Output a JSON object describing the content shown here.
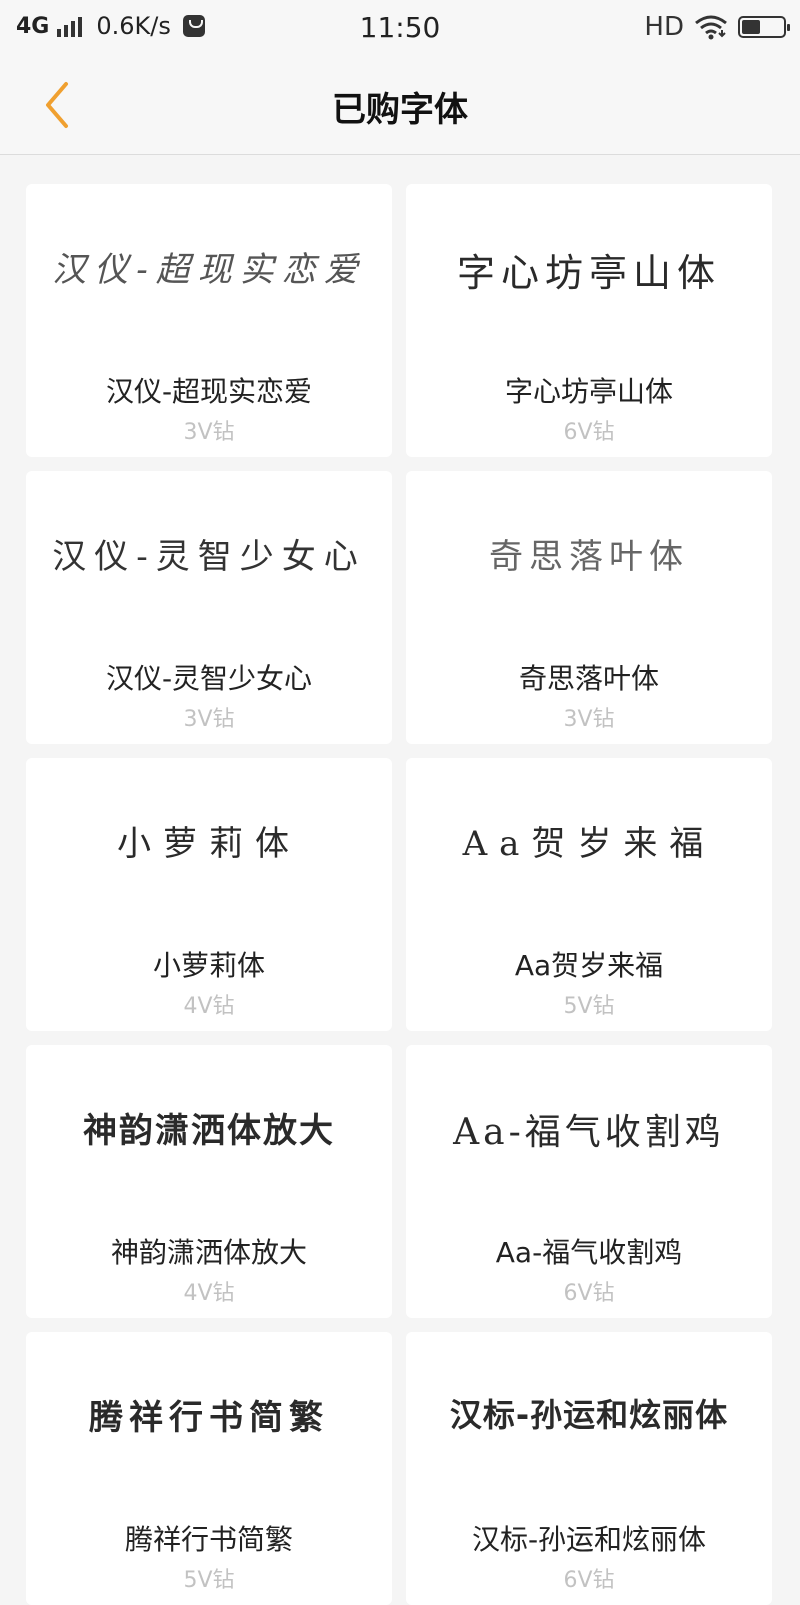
{
  "status_bar": {
    "network": "4G",
    "speed": "0.6K/s",
    "time": "11:50",
    "hd": "HD",
    "battery_level": 0.5
  },
  "header": {
    "title": "已购字体",
    "back_icon": "chevron-left-icon",
    "accent_color": "#f0a030"
  },
  "fonts": [
    {
      "preview": "汉仪-超现实恋爱",
      "name": "汉仪-超现实恋爱",
      "price": "3V钻"
    },
    {
      "preview": "字心坊亭山体",
      "name": "字心坊亭山体",
      "price": "6V钻"
    },
    {
      "preview": "汉仪-灵智少女心",
      "name": "汉仪-灵智少女心",
      "price": "3V钻"
    },
    {
      "preview": "奇思落叶体",
      "name": "奇思落叶体",
      "price": "3V钻"
    },
    {
      "preview": "小萝莉体",
      "name": "小萝莉体",
      "price": "4V钻"
    },
    {
      "preview": "Aa贺岁来福",
      "name": "Aa贺岁来福",
      "price": "5V钻"
    },
    {
      "preview": "神韵潇洒体放大",
      "name": "神韵潇洒体放大",
      "price": "4V钻"
    },
    {
      "preview": "Aa-福气收割鸡",
      "name": "Aa-福气收割鸡",
      "price": "6V钻"
    },
    {
      "preview": "腾祥行书简繁",
      "name": "腾祥行书简繁",
      "price": "5V钻"
    },
    {
      "preview": "汉标-孙运和炫丽体",
      "name": "汉标-孙运和炫丽体",
      "price": "6V钻"
    }
  ]
}
